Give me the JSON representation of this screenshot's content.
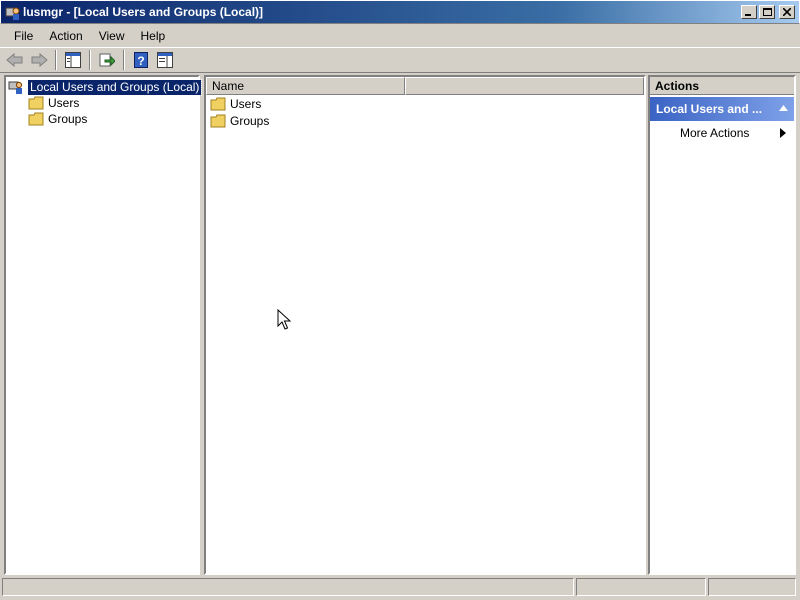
{
  "window": {
    "title": "lusmgr - [Local Users and Groups (Local)]",
    "icon": "users-groups-mmc-icon"
  },
  "menu": {
    "items": [
      "File",
      "Action",
      "View",
      "Help"
    ]
  },
  "toolbar": {
    "buttons": [
      "back-arrow-icon",
      "forward-arrow-icon",
      "show-hide-console-tree-icon",
      "export-list-icon",
      "help-icon",
      "show-hide-action-pane-icon"
    ]
  },
  "tree": {
    "root": "Local Users and Groups (Local)",
    "children": [
      "Users",
      "Groups"
    ]
  },
  "list": {
    "columns": [
      "Name"
    ],
    "rows": [
      "Users",
      "Groups"
    ]
  },
  "actions": {
    "title": "Actions",
    "section": "Local Users and ...",
    "items": [
      "More Actions"
    ]
  },
  "colors": {
    "selection": "#0a246a",
    "title_gradient_start": "#0a246a",
    "actions_header": "#3b63c4",
    "folder": "#f0d060"
  }
}
